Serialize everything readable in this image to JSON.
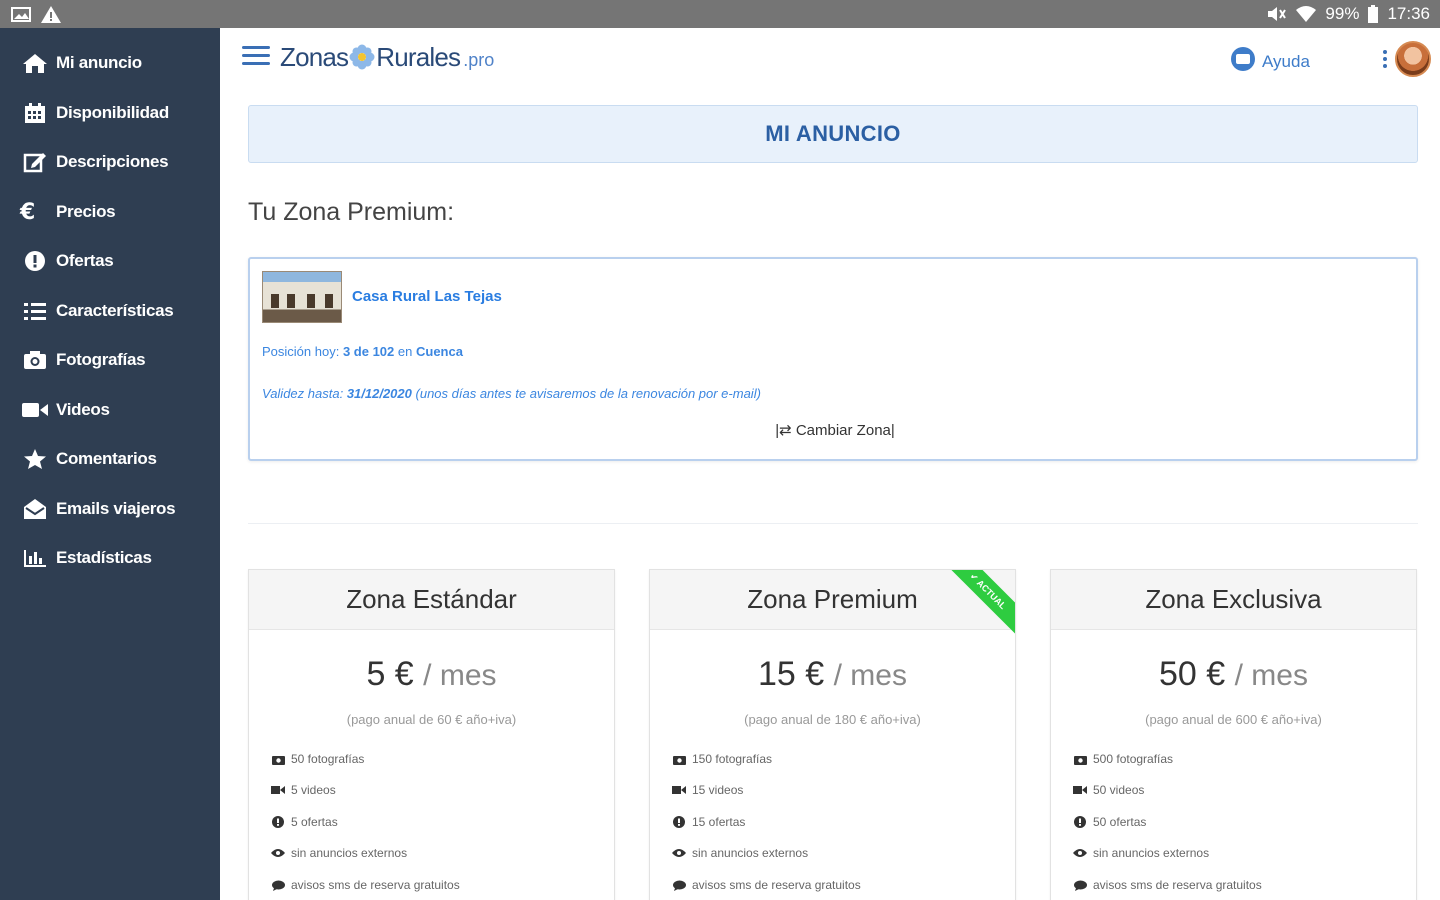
{
  "status_bar": {
    "battery": "99%",
    "time": "17:36"
  },
  "sidebar": {
    "items": [
      {
        "label": "Mi anuncio",
        "icon": "home-icon"
      },
      {
        "label": "Disponibilidad",
        "icon": "calendar-icon"
      },
      {
        "label": "Descripciones",
        "icon": "edit-icon"
      },
      {
        "label": "Precios",
        "icon": "euro-icon"
      },
      {
        "label": "Ofertas",
        "icon": "alert-circle-icon"
      },
      {
        "label": "Características",
        "icon": "list-icon"
      },
      {
        "label": "Fotografías",
        "icon": "camera-icon"
      },
      {
        "label": "Videos",
        "icon": "video-icon"
      },
      {
        "label": "Comentarios",
        "icon": "star-icon"
      },
      {
        "label": "Emails viajeros",
        "icon": "envelope-open-icon"
      },
      {
        "label": "Estadísticas",
        "icon": "bar-chart-icon"
      }
    ]
  },
  "header": {
    "logo_left": "Zonas",
    "logo_right": "Rurales",
    "logo_suffix": ".pro",
    "help_label": "Ayuda"
  },
  "main": {
    "title": "MI ANUNCIO",
    "zone_heading": "Tu Zona Premium:",
    "zone_card": {
      "house_name": "Casa Rural Las Tejas",
      "position_prefix": "Posición hoy:",
      "position_value": "3 de 102",
      "position_in": "en",
      "position_place": "Cuenca",
      "validity_prefix": "Validez hasta:",
      "validity_date": "31/12/2020",
      "validity_note": "(unos días antes te avisaremos de la renovación por e-mail)",
      "change_zone": "|⇄ Cambiar Zona|"
    },
    "plans": [
      {
        "name": "Zona Estándar",
        "price": "5 €",
        "per": "/ mes",
        "annual": "(pago anual de 60 € año+iva)",
        "features": [
          "50 fotografías",
          "5 videos",
          "5 ofertas",
          "sin anuncios externos",
          "avisos sms de reserva gratuitos"
        ]
      },
      {
        "name": "Zona Premium",
        "price": "15 €",
        "per": "/ mes",
        "annual": "(pago anual de 180 € año+iva)",
        "ribbon": "✔ ACTUAL",
        "features": [
          "150 fotografías",
          "15 videos",
          "15 ofertas",
          "sin anuncios externos",
          "avisos sms de reserva gratuitos"
        ]
      },
      {
        "name": "Zona Exclusiva",
        "price": "50 €",
        "per": "/ mes",
        "annual": "(pago anual de 600 € año+iva)",
        "features": [
          "500 fotografías",
          "50 videos",
          "50 ofertas",
          "sin anuncios externos",
          "avisos sms de reserva gratuitos"
        ]
      }
    ]
  },
  "colors": {
    "sidebar_bg": "#2f3e52",
    "accent_blue": "#2b5fa3",
    "link_blue": "#2a7de1",
    "ribbon_green": "#2ecc40",
    "status_bar": "#757575"
  }
}
